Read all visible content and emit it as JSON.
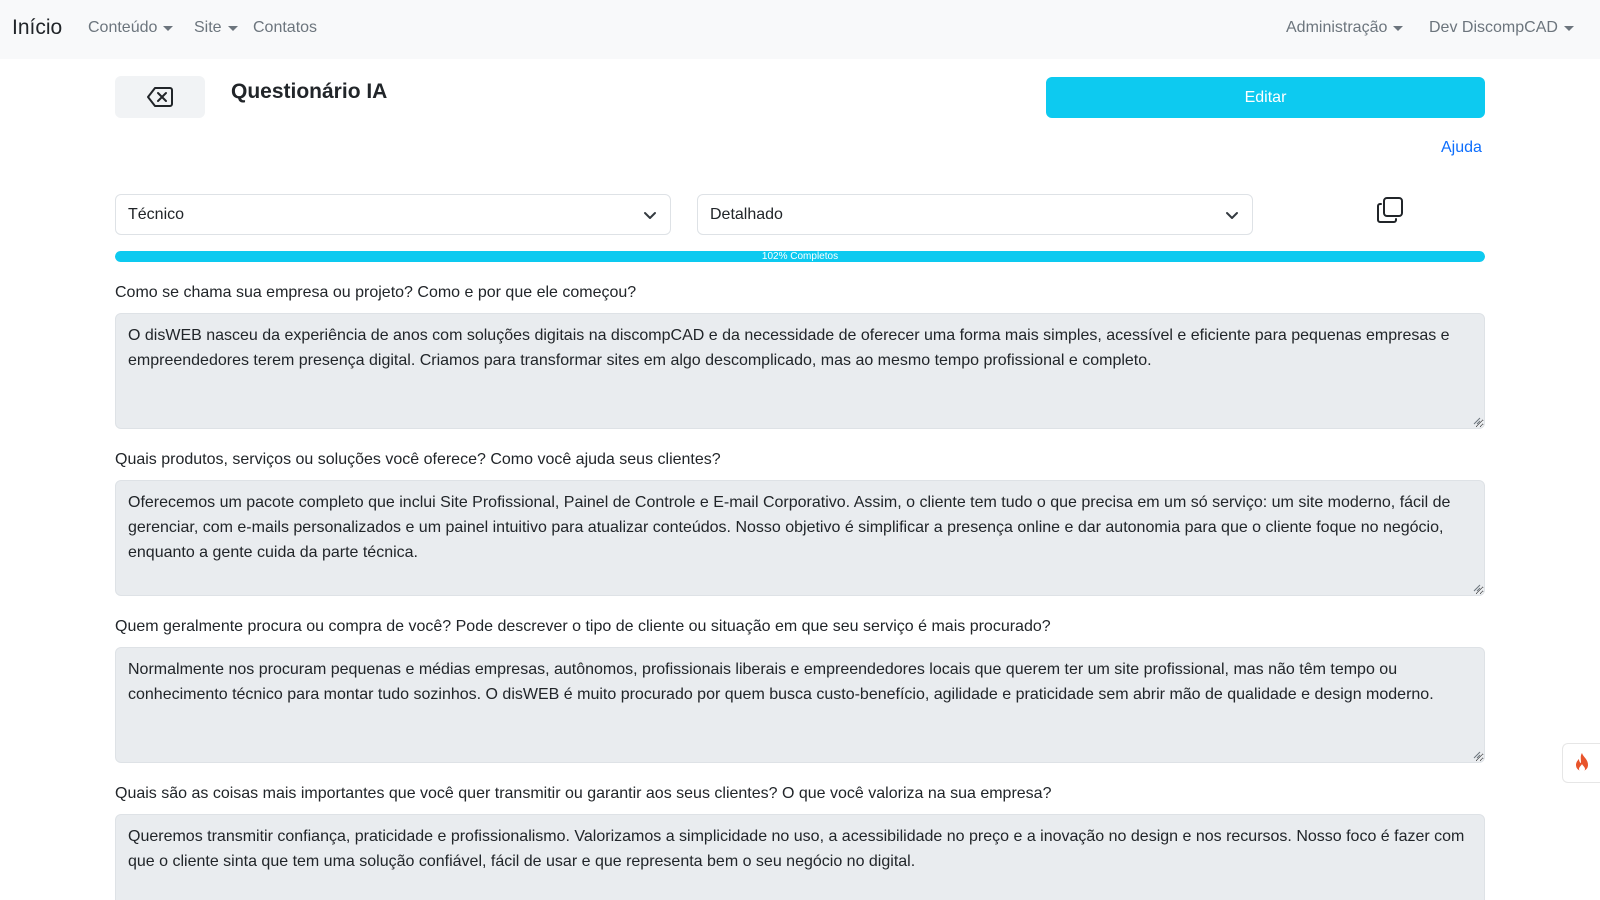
{
  "navbar": {
    "brand": "Início",
    "left_items": [
      "Conteúdo",
      "Site",
      "Contatos"
    ],
    "right_items": [
      "Administração",
      "Dev DiscompCAD"
    ]
  },
  "header": {
    "title": "Questionário IA",
    "edit_label": "Editar",
    "help_label": "Ajuda"
  },
  "filters": {
    "tone": "Técnico",
    "detail": "Detalhado"
  },
  "progress": {
    "label": "102% Completos",
    "percent": 100
  },
  "questions": [
    {
      "question": "Como se chama sua empresa ou projeto? Como e por que ele começou?",
      "answer": "O disWEB nasceu da experiência de anos com soluções digitais na discompCAD e da necessidade de oferecer uma forma mais simples, acessível e eficiente para pequenas empresas e empreendedores terem presença digital. Criamos para transformar sites em algo descomplicado, mas ao mesmo tempo profissional e completo."
    },
    {
      "question": "Quais produtos, serviços ou soluções você oferece? Como você ajuda seus clientes?",
      "answer": "Oferecemos um pacote completo que inclui Site Profissional, Painel de Controle e E-mail Corporativo. Assim, o cliente tem tudo o que precisa em um só serviço: um site moderno, fácil de gerenciar, com e-mails personalizados e um painel intuitivo para atualizar conteúdos. Nosso objetivo é simplificar a presença online e dar autonomia para que o cliente foque no negócio, enquanto a gente cuida da parte técnica."
    },
    {
      "question": "Quem geralmente procura ou compra de você? Pode descrever o tipo de cliente ou situação em que seu serviço é mais procurado?",
      "answer": "Normalmente nos procuram pequenas e médias empresas, autônomos, profissionais liberais e empreendedores locais que querem ter um site profissional, mas não têm tempo ou conhecimento técnico para montar tudo sozinhos. O disWEB é muito procurado por quem busca custo-benefício, agilidade e praticidade sem abrir mão de qualidade e design moderno."
    },
    {
      "question": "Quais são as coisas mais importantes que você quer transmitir ou garantir aos seus clientes? O que você valoriza na sua empresa?",
      "answer": "Queremos transmitir confiança, praticidade e profissionalismo. Valorizamos a simplicidade no uso, a acessibilidade no preço e a inovação no design e nos recursos. Nosso foco é fazer com que o cliente sinta que tem uma solução confiável, fácil de usar e que representa bem o seu negócio no digital."
    }
  ],
  "colors": {
    "accent": "#0dcaf0",
    "link": "#0d6efd",
    "fire": "#e8542b"
  },
  "icons": {
    "back": "backspace-icon",
    "chevron": "chevron-down-icon",
    "copy": "copy-icon",
    "fire": "fire-icon"
  }
}
